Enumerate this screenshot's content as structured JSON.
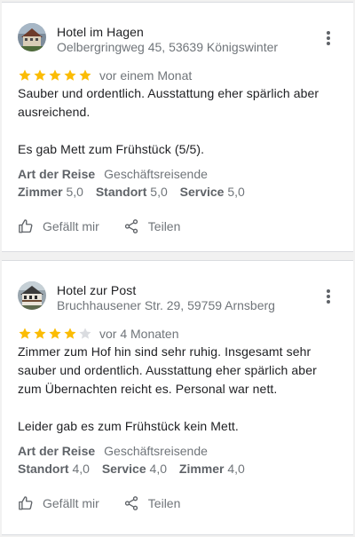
{
  "reviews": [
    {
      "hotel_name": "Hotel im Hagen",
      "address": "Oelbergringweg 45, 53639 Königswinter",
      "stars": 5,
      "stars_max": 5,
      "time": "vor einem Monat",
      "text_lines": [
        "Sauber und ordentlich. Ausstattung eher spärlich aber",
        "ausreichend."
      ],
      "text_lines_2": [
        "Es gab Mett zum Frühstück (5/5)."
      ],
      "trip_label": "Art der Reise",
      "trip_value": "Geschäftsreisende",
      "ratings": [
        {
          "label": "Zimmer",
          "value": "5,0"
        },
        {
          "label": "Standort",
          "value": "5,0"
        },
        {
          "label": "Service",
          "value": "5,0"
        }
      ]
    },
    {
      "hotel_name": "Hotel zur Post",
      "address": "Bruchhausener Str. 29, 59759 Arnsberg",
      "stars": 4,
      "stars_max": 5,
      "time": "vor 4 Monaten",
      "text_lines": [
        "Zimmer zum Hof hin sind sehr ruhig. Insgesamt sehr",
        "sauber und ordentlich. Ausstattung eher spärlich aber",
        "zum Übernachten reicht es. Personal war nett."
      ],
      "text_lines_2": [
        "Leider gab es zum Frühstück kein Mett."
      ],
      "trip_label": "Art der Reise",
      "trip_value": "Geschäftsreisende",
      "ratings": [
        {
          "label": "Standort",
          "value": "4,0"
        },
        {
          "label": "Service",
          "value": "4,0"
        },
        {
          "label": "Zimmer",
          "value": "4,0"
        }
      ]
    }
  ],
  "actions": {
    "like_label": "Gefällt mir",
    "share_label": "Teilen"
  },
  "icons": {
    "star_filled": "star-icon",
    "star_empty": "star-empty-icon",
    "like": "thumb-up-icon",
    "share": "share-icon",
    "more": "more-vert-icon"
  },
  "colors": {
    "star": "#fbbc04",
    "star_empty": "#dadce0",
    "muted": "#70757a",
    "label": "#5f6368",
    "text": "#202124"
  }
}
